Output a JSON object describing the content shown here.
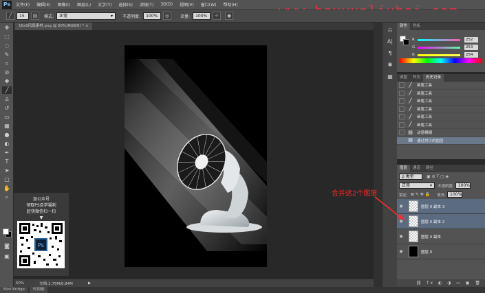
{
  "menu": {
    "app_logo": "Ps",
    "items": [
      "文件(F)",
      "编辑(E)",
      "图像(I)",
      "图层(L)",
      "文字(Y)",
      "选择(S)",
      "滤镜(T)",
      "3D(D)",
      "视图(V)",
      "窗口(W)",
      "帮助(H)"
    ],
    "watermark": "www.hauyunliuhai.com"
  },
  "options_bar": {
    "brush_size": "15",
    "mode_label": "模式:",
    "mode_value": "正常",
    "opacity_label": "不透明度:",
    "opacity_value": "100%",
    "flow_label": "流量:",
    "flow_value": "100%"
  },
  "document": {
    "tab_label": "16x9风扇素材.png @ 50%(RGB/8) *",
    "tab_close": "×"
  },
  "ad": {
    "line1": "加公众号",
    "line2": "领取PS自学福利",
    "line3": "赶快微信扫一扫",
    "arrow": "▼",
    "qr_center": "Ps"
  },
  "status_bar": {
    "zoom": "50%",
    "doc_info": "文档:2.75M/8.84M",
    "nav_arrow": "▶"
  },
  "bottom_tabs": [
    "Mini Bridge",
    "时间轴"
  ],
  "color_panel": {
    "tabs": [
      "颜色",
      "色板"
    ],
    "channels": [
      {
        "label": "R",
        "value": "252"
      },
      {
        "label": "G",
        "value": "253"
      },
      {
        "label": "B",
        "value": "254"
      }
    ],
    "colors": {
      "r_track": "#ff5ab4",
      "g_track": "#5affa0",
      "b_track": "#ffff5a"
    }
  },
  "history_panel": {
    "tabs": [
      "调整",
      "样式",
      "历史记录"
    ],
    "items": [
      {
        "label": "画笔工具",
        "selected": false
      },
      {
        "label": "画笔工具",
        "selected": false
      },
      {
        "label": "画笔工具",
        "selected": false
      },
      {
        "label": "画笔工具",
        "selected": false
      },
      {
        "label": "画笔工具",
        "selected": false
      },
      {
        "label": "画笔工具",
        "selected": false
      },
      {
        "label": "动感模糊",
        "selected": false
      },
      {
        "label": "通过拷贝的图层",
        "selected": true
      }
    ]
  },
  "layers_panel": {
    "tabs": [
      "图层",
      "通道",
      "路径"
    ],
    "filter_label": "ρ 类型",
    "blend_mode": "正常",
    "opacity_label": "不透明度:",
    "opacity_value": "100%",
    "lock_label": "锁定:",
    "fill_label": "填充:",
    "fill_value": "100%",
    "layers": [
      {
        "name": "图层 0 副本 3",
        "selected": true,
        "thumb": "checker"
      },
      {
        "name": "图层 0 副本 2",
        "selected": true,
        "thumb": "checker"
      },
      {
        "name": "图层 0 副本",
        "selected": false,
        "thumb": "checker"
      },
      {
        "name": "图层 0",
        "selected": false,
        "thumb": "black"
      }
    ]
  },
  "annotation": {
    "text": "合并这2个图层",
    "color": "#ff2a2a"
  }
}
